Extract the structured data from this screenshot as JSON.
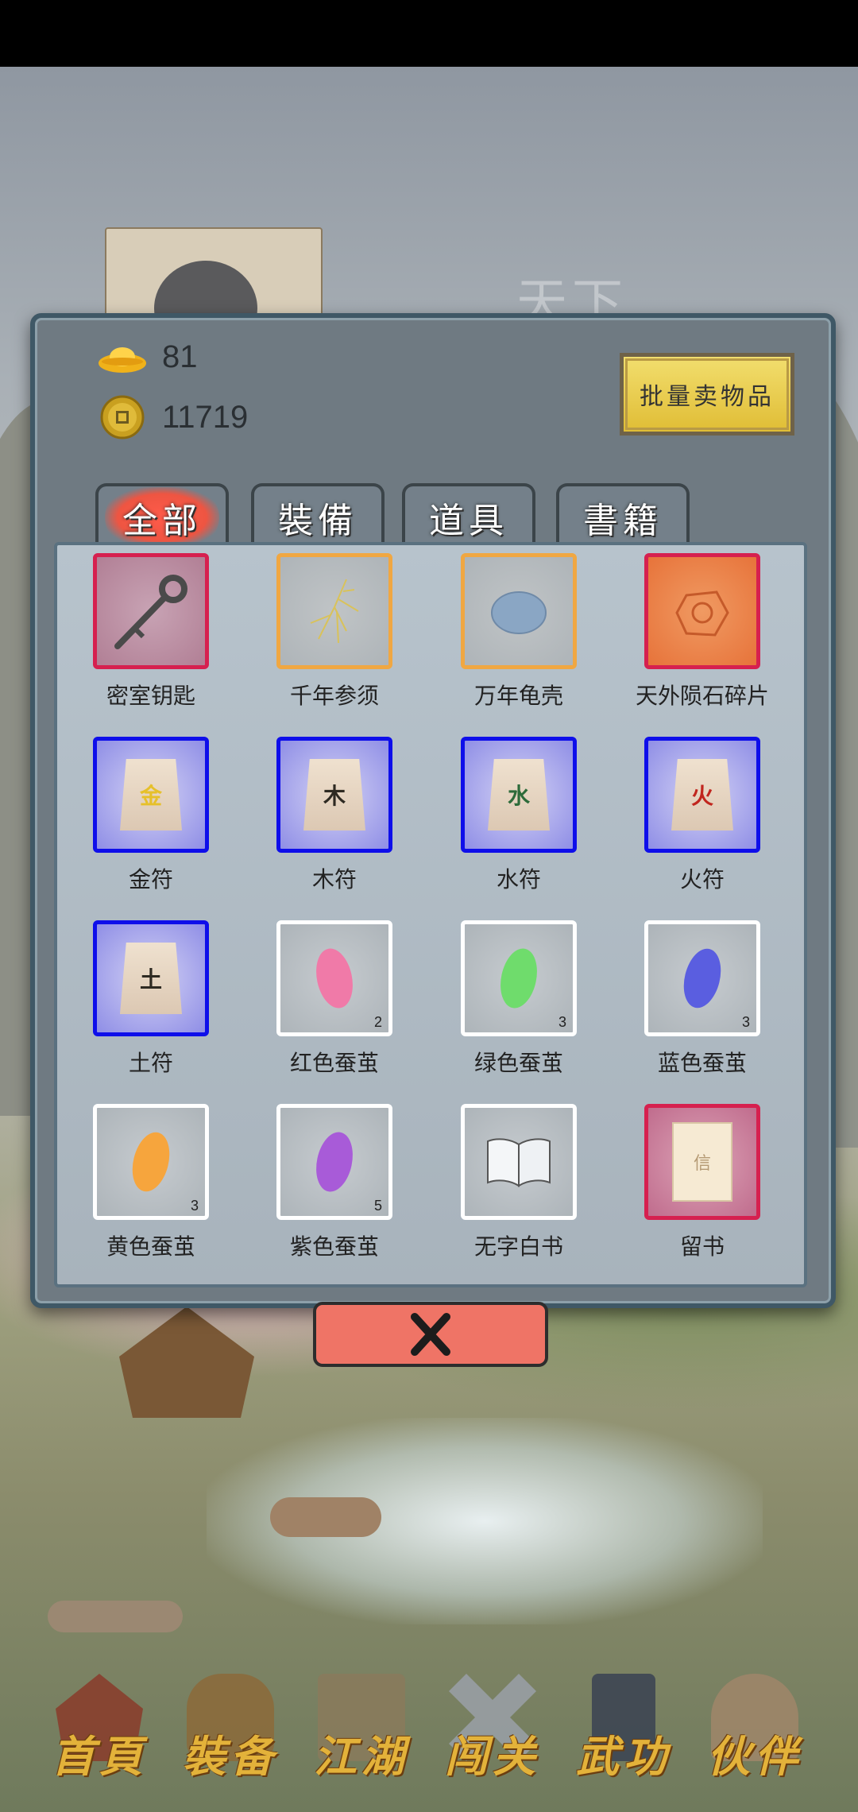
{
  "background": {
    "faded_title": "天下"
  },
  "currency": {
    "gold_ingot": {
      "icon": "gold-ingot-icon",
      "value": "81"
    },
    "copper_coin": {
      "icon": "copper-coin-icon",
      "value": "11719"
    }
  },
  "actions": {
    "bulk_sell_label": "批量卖物品"
  },
  "tabs": [
    {
      "label": "全部",
      "active": true
    },
    {
      "label": "裝備",
      "active": false
    },
    {
      "label": "道具",
      "active": false
    },
    {
      "label": "書籍",
      "active": false
    }
  ],
  "items": [
    {
      "name": "密室钥匙",
      "rarity": "red",
      "icon": "key-icon",
      "count": ""
    },
    {
      "name": "千年参须",
      "rarity": "gold",
      "icon": "ginseng-icon",
      "count": ""
    },
    {
      "name": "万年龟壳",
      "rarity": "gold",
      "icon": "turtle-shell-icon",
      "count": ""
    },
    {
      "name": "天外陨石碎片",
      "rarity": "orange",
      "icon": "meteorite-icon",
      "count": ""
    },
    {
      "name": "金符",
      "rarity": "blue",
      "icon": "talisman-icon",
      "glyph": "金",
      "glyph_color": "#e6c02a",
      "count": ""
    },
    {
      "name": "木符",
      "rarity": "blue",
      "icon": "talisman-icon",
      "glyph": "木",
      "glyph_color": "#2e2a22",
      "count": ""
    },
    {
      "name": "水符",
      "rarity": "blue",
      "icon": "talisman-icon",
      "glyph": "水",
      "glyph_color": "#2d6b3a",
      "count": ""
    },
    {
      "name": "火符",
      "rarity": "blue",
      "icon": "talisman-icon",
      "glyph": "火",
      "glyph_color": "#c1261e",
      "count": ""
    },
    {
      "name": "土符",
      "rarity": "blue",
      "icon": "talisman-icon",
      "glyph": "土",
      "glyph_color": "#2e2a22",
      "count": ""
    },
    {
      "name": "红色蚕茧",
      "rarity": "white",
      "icon": "cocoon-icon",
      "cocoon_color": "#f07aa8",
      "count": "2"
    },
    {
      "name": "绿色蚕茧",
      "rarity": "white",
      "icon": "cocoon-icon",
      "cocoon_color": "#6fdc6c",
      "count": "3"
    },
    {
      "name": "蓝色蚕茧",
      "rarity": "white",
      "icon": "cocoon-icon",
      "cocoon_color": "#5a5ee0",
      "count": "3"
    },
    {
      "name": "黄色蚕茧",
      "rarity": "white",
      "icon": "cocoon-icon",
      "cocoon_color": "#f6a53d",
      "count": "3"
    },
    {
      "name": "紫色蚕茧",
      "rarity": "white",
      "icon": "cocoon-icon",
      "cocoon_color": "#a85bd8",
      "count": "5"
    },
    {
      "name": "无字白书",
      "rarity": "white",
      "icon": "blank-book-icon",
      "count": ""
    },
    {
      "name": "留书",
      "rarity": "pink",
      "icon": "letter-icon",
      "glyph": "信",
      "count": ""
    }
  ],
  "close": {
    "icon": "close-x-icon"
  },
  "nav": [
    {
      "label": "首頁",
      "icon": "home-pavilion-icon",
      "color": "#8a3b2a"
    },
    {
      "label": "裝备",
      "icon": "armor-icon",
      "color": "#8c6a3a"
    },
    {
      "label": "江湖",
      "icon": "scroll-map-icon",
      "color": "#8a7a5c"
    },
    {
      "label": "闯关",
      "icon": "crossed-swords-icon",
      "color": "#9aa0a8"
    },
    {
      "label": "武功",
      "icon": "martial-book-icon",
      "color": "#3a4252"
    },
    {
      "label": "伙伴",
      "icon": "companions-icon",
      "color": "#a0866a"
    }
  ]
}
